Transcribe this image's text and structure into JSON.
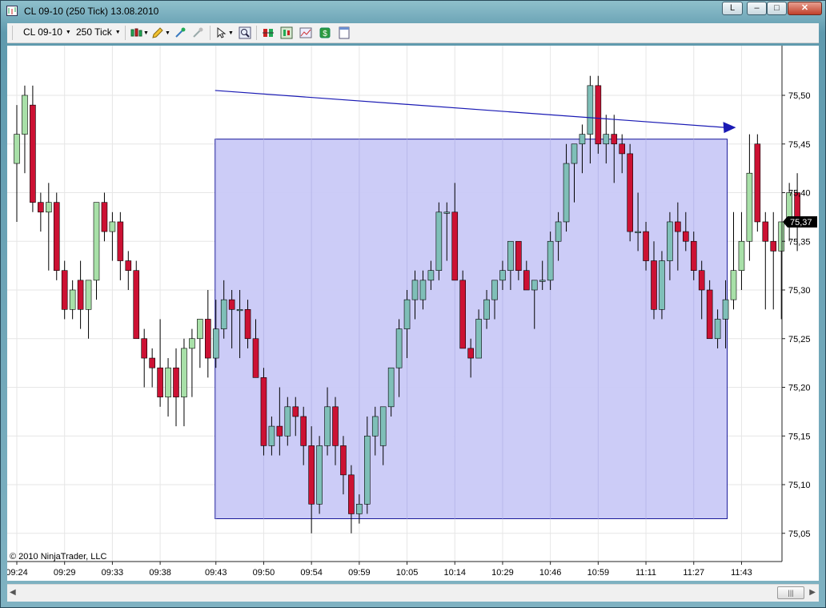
{
  "window": {
    "title": "CL 09-10 (250 Tick)  13.08.2010",
    "controls": {
      "login": "L",
      "minimize": "–",
      "maximize": "□",
      "close": "✕"
    }
  },
  "toolbar": {
    "instrument": "CL 09-10",
    "interval": "250 Tick",
    "icons": [
      "candlestick-style-icon",
      "pencil-drawing-icon",
      "add-indicator-icon",
      "remove-indicator-icon",
      "cursor-pointer-icon",
      "zoom-icon",
      "data-box-icon",
      "strategies-icon",
      "chart-properties-icon",
      "money-icon",
      "panel-icon"
    ]
  },
  "colors": {
    "up_candle": "#a8e0a8",
    "down_candle": "#cc1133",
    "rectangle_fill": "#c9c9f7",
    "rectangle_border": "#1a1a9a",
    "arrow_line": "#1a1ab4",
    "last_price_bg": "#000000"
  },
  "chart_data": {
    "type": "candlestick",
    "y_ticks": [
      "75,50",
      "75,45",
      "75,40",
      "75,35",
      "75,30",
      "75,25",
      "75,20",
      "75,15",
      "75,10",
      "75,05"
    ],
    "x_ticks": [
      "09:24",
      "09:29",
      "09:33",
      "09:38",
      "09:43",
      "09:50",
      "09:54",
      "09:59",
      "10:05",
      "10:14",
      "10:29",
      "10:46",
      "10:59",
      "11:11",
      "11:27",
      "11:43"
    ],
    "last_price": "75,37",
    "copyright": "© 2010 NinjaTrader, LLC",
    "ylim": [
      75.02,
      75.53
    ],
    "candles": [
      [
        75.43,
        75.49,
        75.37,
        75.46
      ],
      [
        75.46,
        75.51,
        75.42,
        75.5
      ],
      [
        75.49,
        75.51,
        75.38,
        75.39
      ],
      [
        75.39,
        75.4,
        75.36,
        75.38
      ],
      [
        75.38,
        75.41,
        75.32,
        75.39
      ],
      [
        75.39,
        75.4,
        75.31,
        75.32
      ],
      [
        75.32,
        75.33,
        75.27,
        75.28
      ],
      [
        75.28,
        75.31,
        75.27,
        75.3
      ],
      [
        75.31,
        75.33,
        75.26,
        75.28
      ],
      [
        75.28,
        75.31,
        75.25,
        75.31
      ],
      [
        75.31,
        75.39,
        75.29,
        75.39
      ],
      [
        75.39,
        75.4,
        75.35,
        75.36
      ],
      [
        75.36,
        75.38,
        75.33,
        75.37
      ],
      [
        75.37,
        75.38,
        75.31,
        75.33
      ],
      [
        75.33,
        75.34,
        75.3,
        75.32
      ],
      [
        75.32,
        75.33,
        75.25,
        75.25
      ],
      [
        75.25,
        75.26,
        75.2,
        75.23
      ],
      [
        75.23,
        75.24,
        75.2,
        75.22
      ],
      [
        75.22,
        75.27,
        75.18,
        75.19
      ],
      [
        75.19,
        75.23,
        75.17,
        75.22
      ],
      [
        75.22,
        75.24,
        75.16,
        75.19
      ],
      [
        75.19,
        75.25,
        75.16,
        75.24
      ],
      [
        75.24,
        75.26,
        75.19,
        75.25
      ],
      [
        75.25,
        75.27,
        75.22,
        75.27
      ],
      [
        75.27,
        75.3,
        75.21,
        75.23
      ],
      [
        75.23,
        75.29,
        75.22,
        75.26
      ],
      [
        75.26,
        75.31,
        75.25,
        75.29
      ],
      [
        75.29,
        75.3,
        75.24,
        75.28
      ],
      [
        75.28,
        75.3,
        75.23,
        75.28
      ],
      [
        75.28,
        75.29,
        75.24,
        75.25
      ],
      [
        75.25,
        75.27,
        75.21,
        75.21
      ],
      [
        75.21,
        75.22,
        75.13,
        75.14
      ],
      [
        75.14,
        75.17,
        75.13,
        75.16
      ],
      [
        75.16,
        75.2,
        75.13,
        75.15
      ],
      [
        75.15,
        75.19,
        75.14,
        75.18
      ],
      [
        75.18,
        75.19,
        75.15,
        75.17
      ],
      [
        75.17,
        75.18,
        75.12,
        75.14
      ],
      [
        75.14,
        75.16,
        75.05,
        75.08
      ],
      [
        75.08,
        75.15,
        75.07,
        75.14
      ],
      [
        75.14,
        75.2,
        75.13,
        75.18
      ],
      [
        75.18,
        75.19,
        75.12,
        75.14
      ],
      [
        75.14,
        75.15,
        75.09,
        75.11
      ],
      [
        75.11,
        75.12,
        75.05,
        75.07
      ],
      [
        75.07,
        75.09,
        75.06,
        75.08
      ],
      [
        75.08,
        75.17,
        75.07,
        75.15
      ],
      [
        75.15,
        75.18,
        75.13,
        75.17
      ],
      [
        75.14,
        75.18,
        75.12,
        75.18
      ],
      [
        75.18,
        75.22,
        75.17,
        75.22
      ],
      [
        75.22,
        75.27,
        75.19,
        75.26
      ],
      [
        75.26,
        75.3,
        75.23,
        75.29
      ],
      [
        75.29,
        75.32,
        75.27,
        75.31
      ],
      [
        75.29,
        75.32,
        75.28,
        75.31
      ],
      [
        75.31,
        75.33,
        75.3,
        75.32
      ],
      [
        75.32,
        75.39,
        75.31,
        75.38
      ],
      [
        75.38,
        75.39,
        75.33,
        75.38
      ],
      [
        75.38,
        75.41,
        75.31,
        75.31
      ],
      [
        75.31,
        75.32,
        75.24,
        75.24
      ],
      [
        75.24,
        75.25,
        75.21,
        75.23
      ],
      [
        75.23,
        75.28,
        75.23,
        75.27
      ],
      [
        75.27,
        75.3,
        75.26,
        75.29
      ],
      [
        75.29,
        75.31,
        75.27,
        75.31
      ],
      [
        75.31,
        75.33,
        75.3,
        75.32
      ],
      [
        75.32,
        75.34,
        75.3,
        75.35
      ],
      [
        75.35,
        75.35,
        75.31,
        75.32
      ],
      [
        75.32,
        75.33,
        75.3,
        75.3
      ],
      [
        75.3,
        75.31,
        75.26,
        75.31
      ],
      [
        75.31,
        75.33,
        75.3,
        75.31
      ],
      [
        75.31,
        75.36,
        75.3,
        75.35
      ],
      [
        75.35,
        75.38,
        75.33,
        75.37
      ],
      [
        75.37,
        75.45,
        75.36,
        75.43
      ],
      [
        75.43,
        75.45,
        75.39,
        75.45
      ],
      [
        75.45,
        75.47,
        75.42,
        75.46
      ],
      [
        75.46,
        75.52,
        75.43,
        75.51
      ],
      [
        75.51,
        75.52,
        75.44,
        75.45
      ],
      [
        75.45,
        75.48,
        75.43,
        75.46
      ],
      [
        75.46,
        75.48,
        75.41,
        75.45
      ],
      [
        75.45,
        75.46,
        75.42,
        75.44
      ],
      [
        75.44,
        75.45,
        75.35,
        75.36
      ],
      [
        75.36,
        75.4,
        75.34,
        75.36
      ],
      [
        75.36,
        75.37,
        75.32,
        75.33
      ],
      [
        75.33,
        75.35,
        75.27,
        75.28
      ],
      [
        75.28,
        75.34,
        75.27,
        75.33
      ],
      [
        75.33,
        75.38,
        75.31,
        75.37
      ],
      [
        75.37,
        75.39,
        75.32,
        75.36
      ],
      [
        75.36,
        75.38,
        75.34,
        75.35
      ],
      [
        75.35,
        75.36,
        75.31,
        75.32
      ],
      [
        75.32,
        75.33,
        75.27,
        75.3
      ],
      [
        75.3,
        75.31,
        75.25,
        75.25
      ],
      [
        75.25,
        75.28,
        75.24,
        75.27
      ],
      [
        75.27,
        75.31,
        75.24,
        75.29
      ],
      [
        75.29,
        75.38,
        75.28,
        75.32
      ],
      [
        75.32,
        75.38,
        75.3,
        75.35
      ],
      [
        75.35,
        75.46,
        75.33,
        75.42
      ],
      [
        75.45,
        75.46,
        75.36,
        75.37
      ],
      [
        75.37,
        75.38,
        75.28,
        75.35
      ],
      [
        75.35,
        75.38,
        75.28,
        75.34
      ],
      [
        75.34,
        75.37,
        75.27,
        75.37
      ],
      [
        75.37,
        75.41,
        75.35,
        75.4
      ],
      [
        75.4,
        75.42,
        75.34,
        75.37
      ]
    ],
    "drawings": {
      "rectangle": {
        "price_top": 75.455,
        "price_bottom": 75.065,
        "from_bar": 25,
        "to_bar": 89
      },
      "arrow_line": {
        "price_start": 75.505,
        "price_end": 75.467,
        "from_bar": 25,
        "to_bar": 90
      }
    }
  }
}
